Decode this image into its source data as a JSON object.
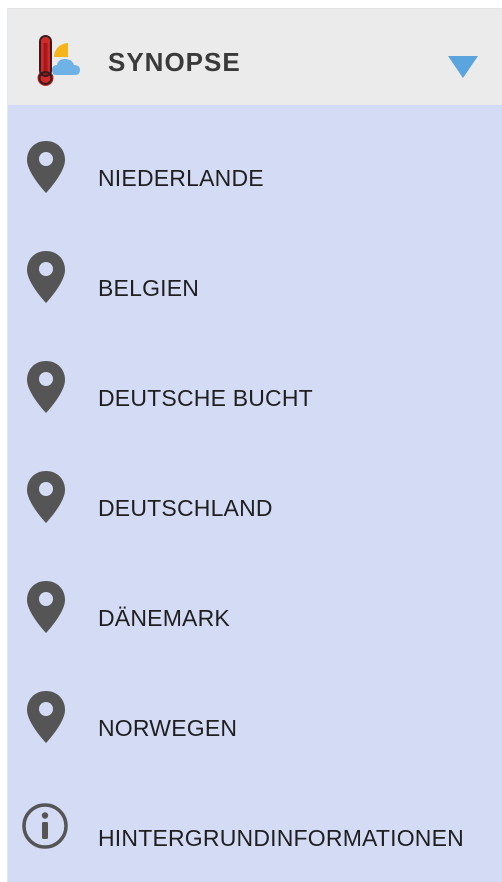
{
  "header": {
    "title": "SYNOPSE",
    "icon": "thermometer-weather-icon",
    "chevron": "chevron-down-icon",
    "accent": "#5aa5de"
  },
  "menu": {
    "items": [
      {
        "label": "NIEDERLANDE",
        "icon": "map-pin-icon"
      },
      {
        "label": "BELGIEN",
        "icon": "map-pin-icon"
      },
      {
        "label": "DEUTSCHE BUCHT",
        "icon": "map-pin-icon"
      },
      {
        "label": "DEUTSCHLAND",
        "icon": "map-pin-icon"
      },
      {
        "label": "DÄNEMARK",
        "icon": "map-pin-icon"
      },
      {
        "label": "NORWEGEN",
        "icon": "map-pin-icon"
      },
      {
        "label": "HINTERGRUNDINFORMATIONEN",
        "icon": "info-icon"
      }
    ]
  },
  "colors": {
    "panel_background": "#d4dcf5",
    "header_background": "#ebebeb",
    "icon_color": "#555555"
  }
}
